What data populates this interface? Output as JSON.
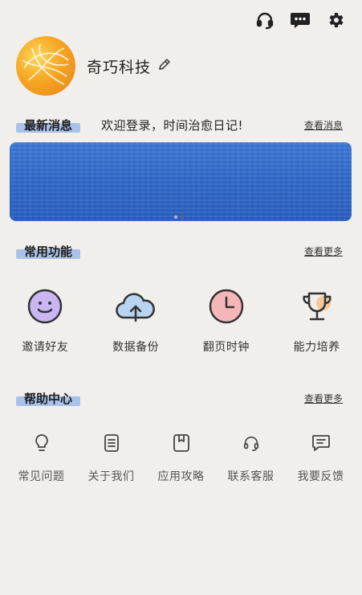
{
  "header": {
    "icons": [
      "headset-icon",
      "message-icon",
      "settings-icon"
    ]
  },
  "profile": {
    "name": "奇巧科技"
  },
  "news": {
    "label": "最新消息",
    "text": "欢迎登录，时间治愈日记!",
    "more": "查看消息"
  },
  "functions": {
    "label": "常用功能",
    "more": "查看更多",
    "items": [
      {
        "label": "邀请好友",
        "icon": "smile-icon"
      },
      {
        "label": "数据备份",
        "icon": "cloud-upload-icon"
      },
      {
        "label": "翻页时钟",
        "icon": "clock-icon"
      },
      {
        "label": "能力培养",
        "icon": "trophy-icon"
      }
    ]
  },
  "help": {
    "label": "帮助中心",
    "more": "查看更多",
    "items": [
      {
        "label": "常见问题",
        "icon": "lightbulb-icon"
      },
      {
        "label": "关于我们",
        "icon": "document-icon"
      },
      {
        "label": "应用攻略",
        "icon": "bookmark-icon"
      },
      {
        "label": "联系客服",
        "icon": "headset-icon"
      },
      {
        "label": "我要反馈",
        "icon": "chat-icon"
      }
    ]
  },
  "colors": {
    "background": "#f1efec",
    "accent_highlight": "#a9c2ec",
    "banner": "#3169c8"
  }
}
